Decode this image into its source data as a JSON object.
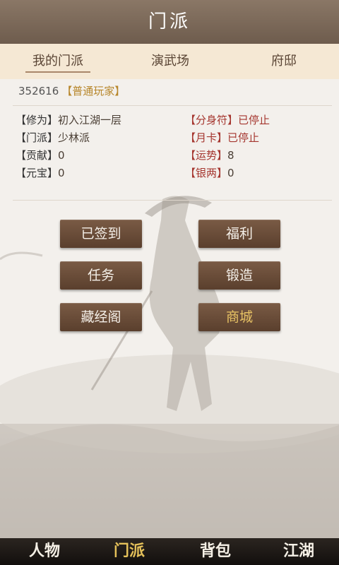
{
  "header": {
    "title": "门派"
  },
  "tabs": [
    {
      "label": "我的门派",
      "active": true
    },
    {
      "label": "演武场",
      "active": false
    },
    {
      "label": "府邸",
      "active": false
    }
  ],
  "player": {
    "id": "352616",
    "tag": "【普通玩家】"
  },
  "stats_left": [
    {
      "key": "【修为】",
      "value": "初入江湖一层"
    },
    {
      "key": "【门派】",
      "value": "少林派"
    },
    {
      "key": "【贡献】",
      "value": "0"
    },
    {
      "key": "【元宝】",
      "value": "0"
    }
  ],
  "stats_right": [
    {
      "key": "【分身符】",
      "value": "已停止"
    },
    {
      "key": "【月卡】",
      "value": "已停止"
    },
    {
      "key": "【运势】",
      "value": "8"
    },
    {
      "key": "【银两】",
      "value": "0"
    }
  ],
  "buttons": [
    {
      "label": "已签到"
    },
    {
      "label": "福利"
    },
    {
      "label": "任务"
    },
    {
      "label": "锻造"
    },
    {
      "label": "藏经阁"
    },
    {
      "label": "商城"
    }
  ],
  "bottom_nav": [
    {
      "label": "人物",
      "active": false
    },
    {
      "label": "门派",
      "active": true
    },
    {
      "label": "背包",
      "active": false
    },
    {
      "label": "江湖",
      "active": false
    }
  ],
  "colors": {
    "accent": "#a5362f",
    "gold": "#e5c15a",
    "header_bg": "#7a6757"
  }
}
